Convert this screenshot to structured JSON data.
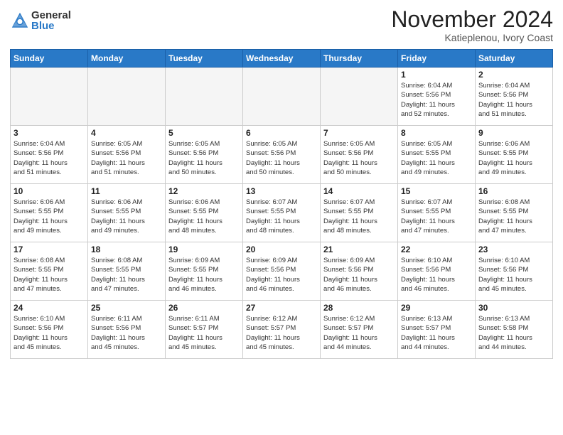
{
  "header": {
    "logo_general": "General",
    "logo_blue": "Blue",
    "month_title": "November 2024",
    "location": "Katieplenou, Ivory Coast"
  },
  "weekdays": [
    "Sunday",
    "Monday",
    "Tuesday",
    "Wednesday",
    "Thursday",
    "Friday",
    "Saturday"
  ],
  "weeks": [
    [
      {
        "day": "",
        "info": ""
      },
      {
        "day": "",
        "info": ""
      },
      {
        "day": "",
        "info": ""
      },
      {
        "day": "",
        "info": ""
      },
      {
        "day": "",
        "info": ""
      },
      {
        "day": "1",
        "info": "Sunrise: 6:04 AM\nSunset: 5:56 PM\nDaylight: 11 hours\nand 52 minutes."
      },
      {
        "day": "2",
        "info": "Sunrise: 6:04 AM\nSunset: 5:56 PM\nDaylight: 11 hours\nand 51 minutes."
      }
    ],
    [
      {
        "day": "3",
        "info": "Sunrise: 6:04 AM\nSunset: 5:56 PM\nDaylight: 11 hours\nand 51 minutes."
      },
      {
        "day": "4",
        "info": "Sunrise: 6:05 AM\nSunset: 5:56 PM\nDaylight: 11 hours\nand 51 minutes."
      },
      {
        "day": "5",
        "info": "Sunrise: 6:05 AM\nSunset: 5:56 PM\nDaylight: 11 hours\nand 50 minutes."
      },
      {
        "day": "6",
        "info": "Sunrise: 6:05 AM\nSunset: 5:56 PM\nDaylight: 11 hours\nand 50 minutes."
      },
      {
        "day": "7",
        "info": "Sunrise: 6:05 AM\nSunset: 5:56 PM\nDaylight: 11 hours\nand 50 minutes."
      },
      {
        "day": "8",
        "info": "Sunrise: 6:05 AM\nSunset: 5:55 PM\nDaylight: 11 hours\nand 49 minutes."
      },
      {
        "day": "9",
        "info": "Sunrise: 6:06 AM\nSunset: 5:55 PM\nDaylight: 11 hours\nand 49 minutes."
      }
    ],
    [
      {
        "day": "10",
        "info": "Sunrise: 6:06 AM\nSunset: 5:55 PM\nDaylight: 11 hours\nand 49 minutes."
      },
      {
        "day": "11",
        "info": "Sunrise: 6:06 AM\nSunset: 5:55 PM\nDaylight: 11 hours\nand 49 minutes."
      },
      {
        "day": "12",
        "info": "Sunrise: 6:06 AM\nSunset: 5:55 PM\nDaylight: 11 hours\nand 48 minutes."
      },
      {
        "day": "13",
        "info": "Sunrise: 6:07 AM\nSunset: 5:55 PM\nDaylight: 11 hours\nand 48 minutes."
      },
      {
        "day": "14",
        "info": "Sunrise: 6:07 AM\nSunset: 5:55 PM\nDaylight: 11 hours\nand 48 minutes."
      },
      {
        "day": "15",
        "info": "Sunrise: 6:07 AM\nSunset: 5:55 PM\nDaylight: 11 hours\nand 47 minutes."
      },
      {
        "day": "16",
        "info": "Sunrise: 6:08 AM\nSunset: 5:55 PM\nDaylight: 11 hours\nand 47 minutes."
      }
    ],
    [
      {
        "day": "17",
        "info": "Sunrise: 6:08 AM\nSunset: 5:55 PM\nDaylight: 11 hours\nand 47 minutes."
      },
      {
        "day": "18",
        "info": "Sunrise: 6:08 AM\nSunset: 5:55 PM\nDaylight: 11 hours\nand 47 minutes."
      },
      {
        "day": "19",
        "info": "Sunrise: 6:09 AM\nSunset: 5:55 PM\nDaylight: 11 hours\nand 46 minutes."
      },
      {
        "day": "20",
        "info": "Sunrise: 6:09 AM\nSunset: 5:56 PM\nDaylight: 11 hours\nand 46 minutes."
      },
      {
        "day": "21",
        "info": "Sunrise: 6:09 AM\nSunset: 5:56 PM\nDaylight: 11 hours\nand 46 minutes."
      },
      {
        "day": "22",
        "info": "Sunrise: 6:10 AM\nSunset: 5:56 PM\nDaylight: 11 hours\nand 46 minutes."
      },
      {
        "day": "23",
        "info": "Sunrise: 6:10 AM\nSunset: 5:56 PM\nDaylight: 11 hours\nand 45 minutes."
      }
    ],
    [
      {
        "day": "24",
        "info": "Sunrise: 6:10 AM\nSunset: 5:56 PM\nDaylight: 11 hours\nand 45 minutes."
      },
      {
        "day": "25",
        "info": "Sunrise: 6:11 AM\nSunset: 5:56 PM\nDaylight: 11 hours\nand 45 minutes."
      },
      {
        "day": "26",
        "info": "Sunrise: 6:11 AM\nSunset: 5:57 PM\nDaylight: 11 hours\nand 45 minutes."
      },
      {
        "day": "27",
        "info": "Sunrise: 6:12 AM\nSunset: 5:57 PM\nDaylight: 11 hours\nand 45 minutes."
      },
      {
        "day": "28",
        "info": "Sunrise: 6:12 AM\nSunset: 5:57 PM\nDaylight: 11 hours\nand 44 minutes."
      },
      {
        "day": "29",
        "info": "Sunrise: 6:13 AM\nSunset: 5:57 PM\nDaylight: 11 hours\nand 44 minutes."
      },
      {
        "day": "30",
        "info": "Sunrise: 6:13 AM\nSunset: 5:58 PM\nDaylight: 11 hours\nand 44 minutes."
      }
    ]
  ]
}
